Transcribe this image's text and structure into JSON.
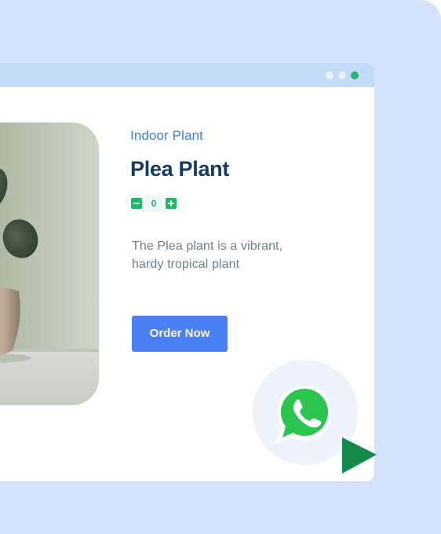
{
  "colors": {
    "background": "#d7e3fd",
    "titlebar": "#c3dbf7",
    "accent_blue": "#4a7ff6",
    "category_blue": "#3f7ee8",
    "title_navy": "#163b62",
    "green": "#1bb866",
    "whatsapp_green": "#2ac54f"
  },
  "window": {
    "controls": [
      "dot",
      "dot",
      "dot"
    ]
  },
  "product": {
    "category": "Indoor Plant",
    "name": "Plea Plant",
    "quantity": "0",
    "description": "The Plea plant is a vibrant, hardy tropical plant",
    "order_label": "Order Now"
  },
  "icons": {
    "decrement": "minus-icon",
    "increment": "plus-icon",
    "chat": "whatsapp-icon",
    "pointer": "cursor-arrow-icon"
  }
}
